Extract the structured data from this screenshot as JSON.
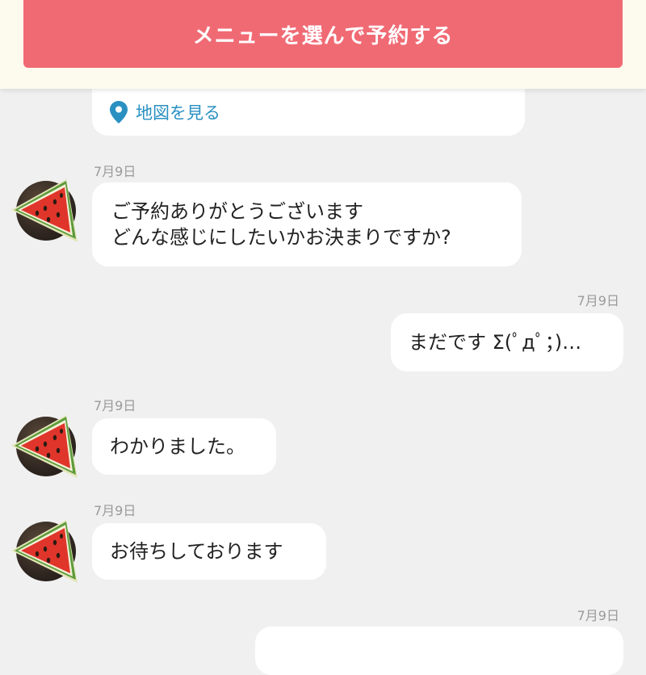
{
  "header": {
    "reserve_button": "メニューを選んで予約する"
  },
  "map_card": {
    "link_label": "地図を見る"
  },
  "messages": [
    {
      "side": "left",
      "date": "7月9日",
      "lines": [
        "ご予約ありがとうございます",
        "どんな感じにしたいかお決まりですか?"
      ]
    },
    {
      "side": "right",
      "date": "7月9日",
      "lines": [
        "まだです Σ(ﾟдﾟ；)…"
      ]
    },
    {
      "side": "left",
      "date": "7月9日",
      "lines": [
        "わかりました。"
      ]
    },
    {
      "side": "left",
      "date": "7月9日",
      "lines": [
        "お待ちしております"
      ]
    },
    {
      "side": "right",
      "date": "7月9日",
      "lines": [
        ""
      ]
    }
  ],
  "colors": {
    "accent_button": "#f06a74",
    "header_background": "#fdfbee",
    "link": "#2a90c2",
    "chat_background": "#f0f0f0"
  },
  "icons": [
    "map-pin-icon",
    "watermelon-avatar-icon"
  ]
}
